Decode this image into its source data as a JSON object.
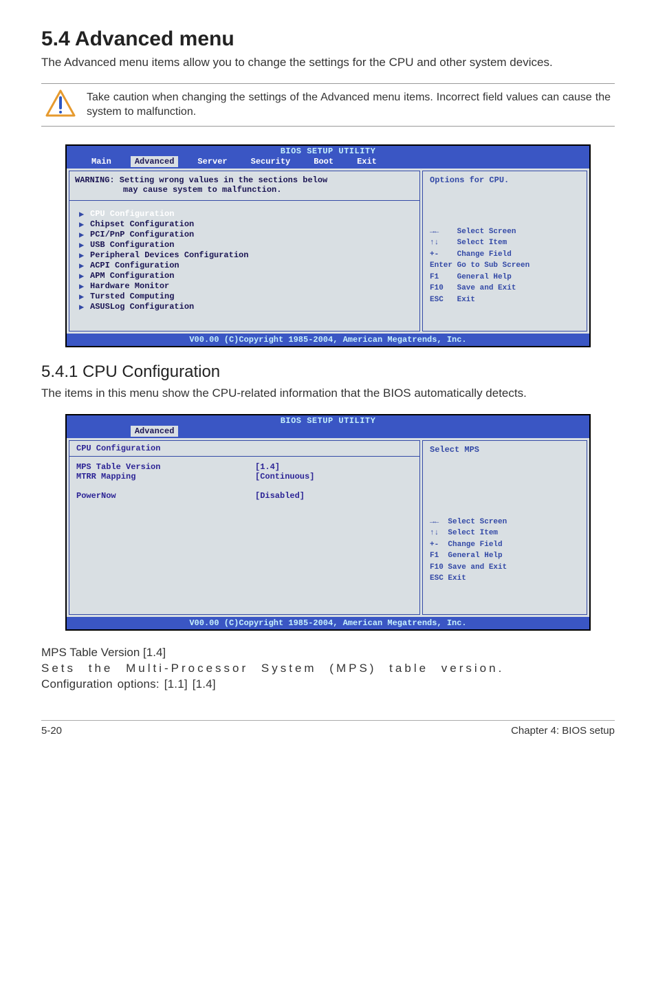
{
  "heading": "5.4 Advanced menu",
  "intro": "The Advanced menu items allow you to change the settings for the CPU and other system devices.",
  "callout": "Take caution when changing the settings of the Advanced menu items. Incorrect field values can cause the system to malfunction.",
  "bios1": {
    "title": "BIOS SETUP UTILITY",
    "tabs": [
      "Main",
      "Advanced",
      "Server",
      "Security",
      "Boot",
      "Exit"
    ],
    "active_tab": "Advanced",
    "warning1": "WARNING: Setting wrong values in the sections below",
    "warning2": "may cause system to malfunction.",
    "items": [
      "CPU Configuration",
      "Chipset Configuration",
      "PCI/PnP Configuration",
      "USB Configuration",
      "Peripheral Devices Configuration",
      "ACPI Configuration",
      "APM Configuration",
      "Hardware Monitor",
      "Tursted Computing",
      "ASUSLog Configuration"
    ],
    "help_title": "Options for CPU.",
    "help_keys": [
      "→←    Select Screen",
      "↑↓    Select Item",
      "+-    Change Field",
      "Enter Go to Sub Screen",
      "F1    General Help",
      "F10   Save and Exit",
      "ESC   Exit"
    ],
    "footer": "V00.00 (C)Copyright 1985-2004, American Megatrends, Inc."
  },
  "section2_heading": "5.4.1 CPU Configuration",
  "section2_intro": "The items in this menu show the CPU-related information that the BIOS automatically detects.",
  "bios2": {
    "title": "BIOS SETUP UTILITY",
    "tabs_blank": [
      "Advanced"
    ],
    "header": "CPU Configuration",
    "rows": [
      {
        "lbl": "MPS Table Version",
        "val": "[1.4]"
      },
      {
        "lbl": "MTRR Mapping",
        "val": "[Continuous]"
      },
      {
        "lbl": "",
        "val": ""
      },
      {
        "lbl": "PowerNow",
        "val": "[Disabled]"
      }
    ],
    "help_title": "Select MPS",
    "help_keys": [
      "→←  Select Screen",
      "↑↓  Select Item",
      "+-  Change Field",
      "F1  General Help",
      "F10 Save and Exit",
      "ESC Exit"
    ],
    "footer": "V00.00 (C)Copyright 1985-2004, American Megatrends, Inc."
  },
  "mps_heading": "MPS Table Version [1.4]",
  "mps_line1": "Sets the Multi-Processor System (MPS) table version.",
  "mps_line2": "Configuration options: [1.1] [1.4]",
  "page_left": "5-20",
  "page_right": "Chapter 4: BIOS setup"
}
